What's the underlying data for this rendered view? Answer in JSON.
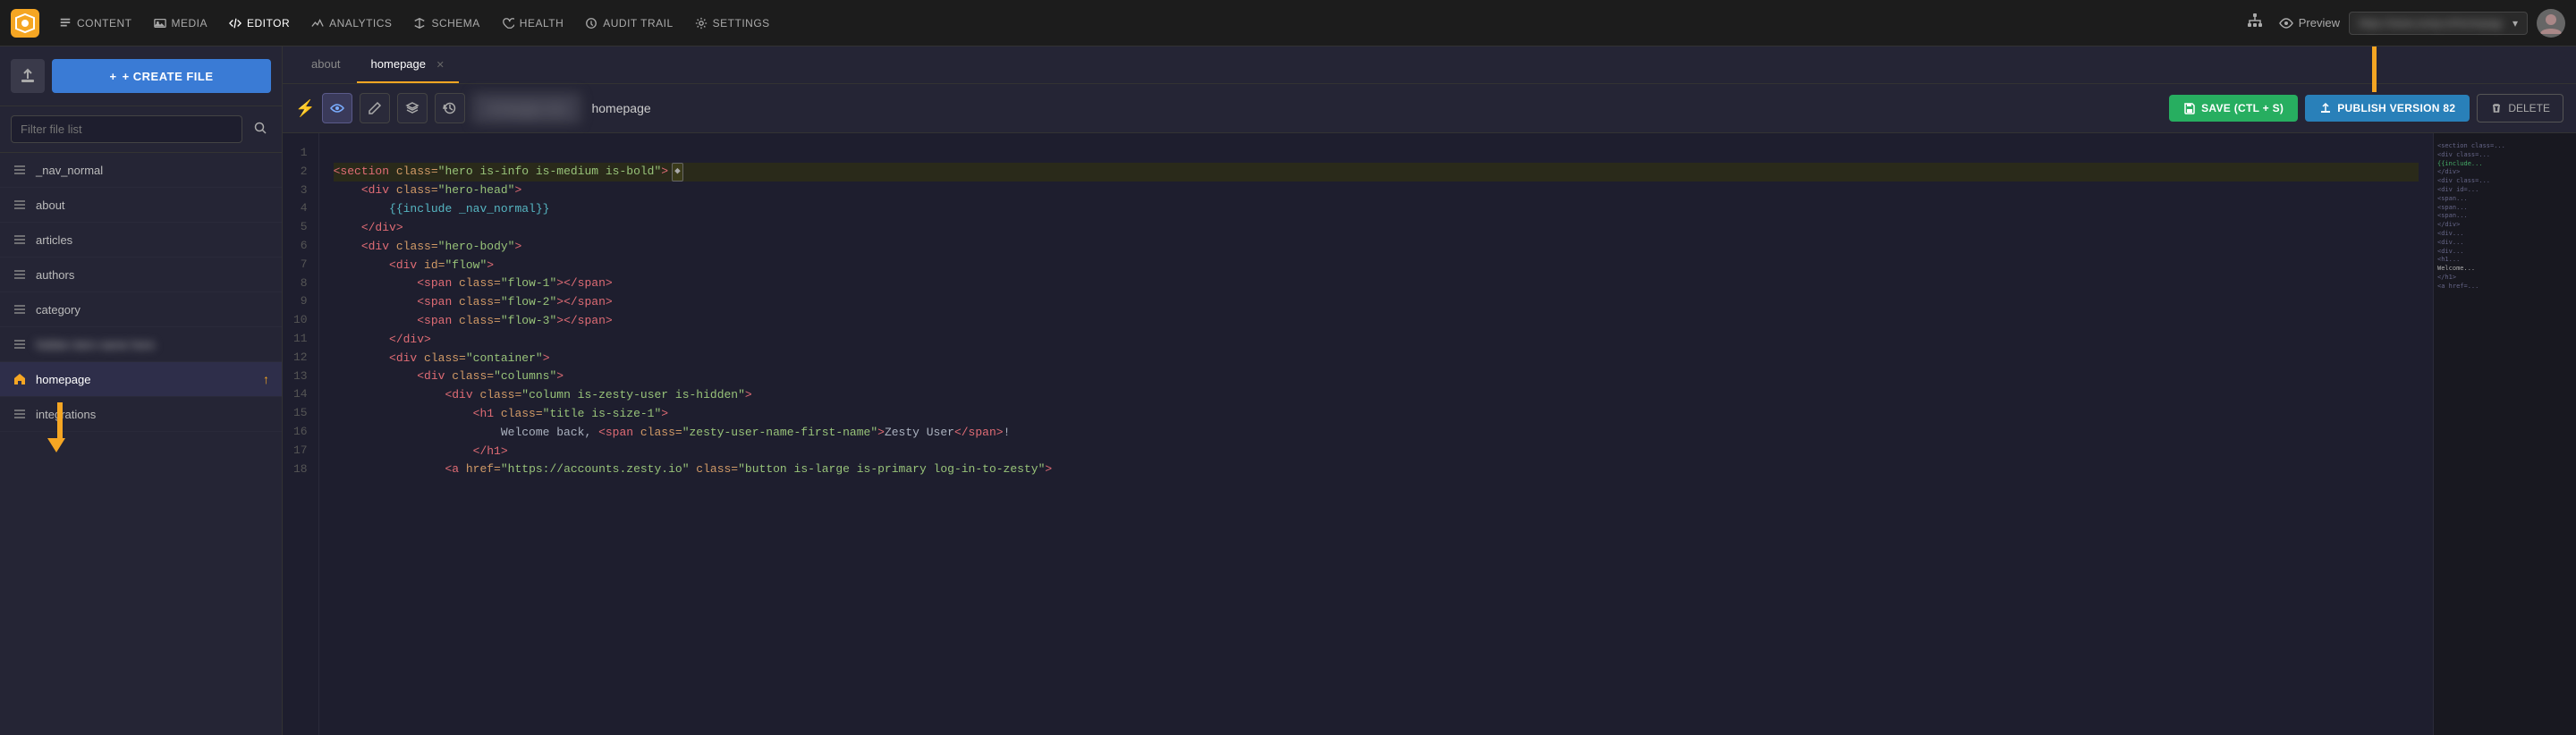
{
  "nav": {
    "items": [
      {
        "id": "content",
        "label": "CONTENT",
        "icon": "file-icon"
      },
      {
        "id": "media",
        "label": "MEDIA",
        "icon": "image-icon"
      },
      {
        "id": "editor",
        "label": "EDITOR",
        "icon": "code-icon"
      },
      {
        "id": "analytics",
        "label": "ANALYTICS",
        "icon": "chart-icon"
      },
      {
        "id": "schema",
        "label": "SCHEMA",
        "icon": "schema-icon"
      },
      {
        "id": "health",
        "label": "HEALTH",
        "icon": "health-icon"
      },
      {
        "id": "audit-trail",
        "label": "AUDIT TRAIL",
        "icon": "audit-icon"
      },
      {
        "id": "settings",
        "label": "SETTINGS",
        "icon": "settings-icon"
      }
    ],
    "preview_label": "Preview",
    "url_placeholder": "Enter URL...",
    "url_value": "https://www.zesty.io/..."
  },
  "sidebar": {
    "upload_title": "Upload",
    "create_label": "+ CREATE FILE",
    "filter_placeholder": "Filter file list",
    "items": [
      {
        "id": "nav-normal",
        "label": "_nav_normal",
        "icon": "list",
        "blurred": false
      },
      {
        "id": "about",
        "label": "about",
        "icon": "list",
        "blurred": false
      },
      {
        "id": "articles",
        "label": "articles",
        "icon": "list",
        "blurred": false
      },
      {
        "id": "authors",
        "label": "authors",
        "icon": "list",
        "blurred": false
      },
      {
        "id": "category",
        "label": "category",
        "icon": "list",
        "blurred": false
      },
      {
        "id": "blurred-item",
        "label": "blurred item",
        "icon": "list",
        "blurred": true
      },
      {
        "id": "homepage",
        "label": "homepage",
        "icon": "page",
        "blurred": false,
        "active": true,
        "hasArrow": true
      },
      {
        "id": "integrations",
        "label": "integrations",
        "icon": "list",
        "blurred": false
      }
    ]
  },
  "tabs": [
    {
      "id": "about",
      "label": "about",
      "active": false,
      "closeable": false
    },
    {
      "id": "homepage",
      "label": "homepage",
      "active": true,
      "closeable": true
    }
  ],
  "toolbar": {
    "filename": "homepage",
    "save_label": "SAVE (CTL + S)",
    "publish_label": "PUBLISH VERSION 82",
    "delete_label": "DELETE"
  },
  "code": {
    "lines": [
      {
        "num": 1,
        "content": "",
        "html": ""
      },
      {
        "num": 2,
        "content": "<section class=\"hero is-info is-medium is-bold\">",
        "highlighted": true
      },
      {
        "num": 3,
        "content": "    <div class=\"hero-head\">"
      },
      {
        "num": 4,
        "content": "        {{include _nav_normal}}"
      },
      {
        "num": 5,
        "content": "    </div>"
      },
      {
        "num": 6,
        "content": "    <div class=\"hero-body\">"
      },
      {
        "num": 7,
        "content": "        <div id=\"flow\">"
      },
      {
        "num": 8,
        "content": "            <span class=\"flow-1\"></span>"
      },
      {
        "num": 9,
        "content": "            <span class=\"flow-2\"></span>"
      },
      {
        "num": 10,
        "content": "            <span class=\"flow-3\"></span>"
      },
      {
        "num": 11,
        "content": "        </div>"
      },
      {
        "num": 12,
        "content": "        <div class=\"container\">"
      },
      {
        "num": 13,
        "content": "            <div class=\"columns\">"
      },
      {
        "num": 14,
        "content": "                <div class=\"column is-zesty-user is-hidden\">"
      },
      {
        "num": 15,
        "content": "                    <h1 class=\"title is-size-1\">"
      },
      {
        "num": 16,
        "content": "                        Welcome back, <span class=\"zesty-user-name-first-name\">Zesty User</span>!"
      },
      {
        "num": 17,
        "content": "                    </h1>"
      },
      {
        "num": 18,
        "content": "                <a href=\"https://accounts.zesty.io\" class=\"button is-large is-primary log-in-to-zesty\">"
      }
    ]
  }
}
